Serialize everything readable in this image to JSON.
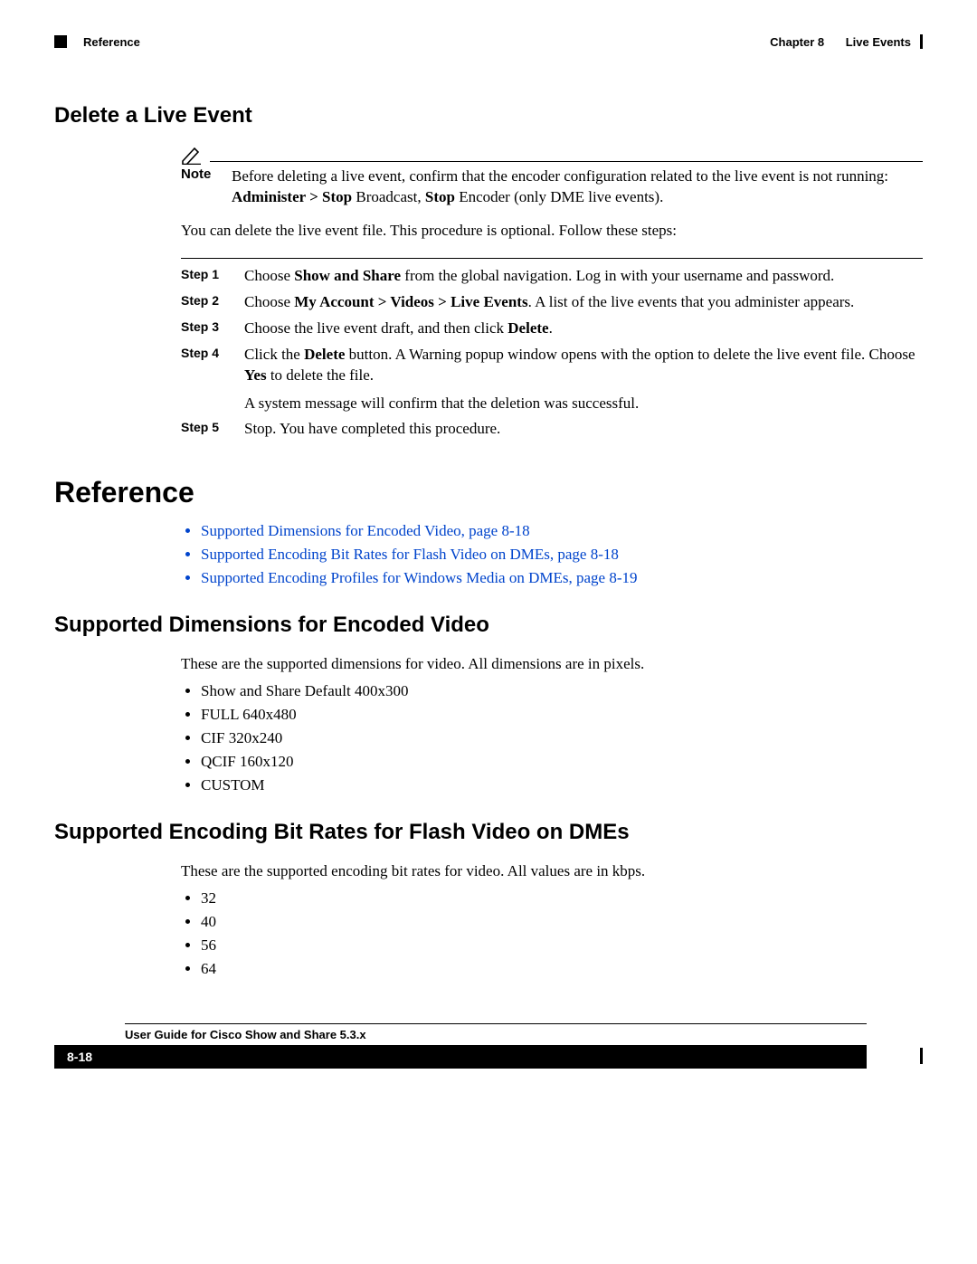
{
  "header": {
    "section": "Reference",
    "chapter_label": "Chapter 8",
    "chapter_title": "Live Events"
  },
  "delete_event": {
    "heading": "Delete a Live Event",
    "note_label": "Note",
    "note_pre": "Before deleting a live event, confirm that the encoder configuration related to the live event is not running: ",
    "note_b1": "Administer > Stop",
    "note_mid1": " Broadcast, ",
    "note_b2": "Stop",
    "note_mid2": " Encoder (only DME live events).",
    "intro": "You can delete the live event file. This procedure is optional. Follow these steps:",
    "steps": [
      {
        "label": "Step 1",
        "pre": "Choose ",
        "b1": "Show and Share",
        "post": " from the global navigation. Log in with your username and password."
      },
      {
        "label": "Step 2",
        "pre": "Choose ",
        "b1": "My Account > Videos > Live Events",
        "post": ". A list of the live events that you administer appears."
      },
      {
        "label": "Step 3",
        "pre": "Choose the live event draft, and then click ",
        "b1": "Delete",
        "post": "."
      },
      {
        "label": "Step 4",
        "pre": "Click the ",
        "b1": "Delete",
        "mid": " button. A Warning popup window opens with the option to delete the live event file. Choose ",
        "b2": "Yes",
        "post": " to delete the file.",
        "tail": "A system message will confirm that the deletion was successful."
      },
      {
        "label": "Step 5",
        "pre": "Stop. You have completed this procedure."
      }
    ]
  },
  "reference": {
    "heading": "Reference",
    "links": [
      "Supported Dimensions for Encoded Video, page 8-18",
      "Supported Encoding Bit Rates for Flash Video on DMEs, page 8-18",
      "Supported Encoding Profiles for Windows Media on DMEs, page 8-19"
    ]
  },
  "dimensions": {
    "heading": "Supported Dimensions for Encoded Video",
    "intro": "These are the supported dimensions for video. All dimensions are in pixels.",
    "items": [
      "Show and Share Default 400x300",
      "FULL 640x480",
      "CIF 320x240",
      "QCIF 160x120",
      "CUSTOM"
    ]
  },
  "bitrates": {
    "heading": "Supported Encoding Bit Rates for Flash Video on DMEs",
    "intro": "These are the supported encoding bit rates for video. All values are in kbps.",
    "items": [
      "32",
      "40",
      "56",
      "64"
    ]
  },
  "footer": {
    "guide": "User Guide for Cisco Show and Share 5.3.x",
    "page": "8-18"
  }
}
